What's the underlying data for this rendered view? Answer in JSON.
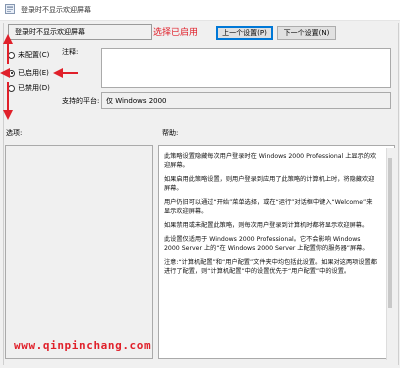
{
  "window": {
    "title": "登录时不显示欢迎屏幕"
  },
  "header": {
    "setting_name": "登录时不显示欢迎屏幕",
    "annotation": "选择已启用",
    "prev_button": "上一个设置(P)",
    "next_button": "下一个设置(N)"
  },
  "options": [
    {
      "label": "未配置(C)",
      "checked": false
    },
    {
      "label": "已启用(E)",
      "checked": true
    },
    {
      "label": "已禁用(D)",
      "checked": false
    }
  ],
  "comment": {
    "label": "注释:",
    "value": ""
  },
  "platform": {
    "label": "支持的平台:",
    "value": "仅 Windows 2000"
  },
  "sections": {
    "options_label": "选项:",
    "help_label": "帮助:"
  },
  "help": [
    "此策略设置隐藏每次用户登录时在 Windows 2000 Professional 上显示的欢迎屏幕。",
    "如果启用此策略设置，则用户登录到应用了此策略的计算机上时，将隐藏欢迎屏幕。",
    "用户仍旧可以通过“开始”菜单选择，或在“运行”对话框中键入“Welcome”来显示欢迎屏幕。",
    "如果禁用或未配置此策略，则每次用户登录到计算机时都将显示欢迎屏幕。",
    "此设置仅适用于 Windows 2000 Professional。它不会影响 Windows 2000 Server 上的“在 Windows 2000 Server 上配置你的服务器”屏幕。",
    "注意:“计算机配置”和“用户配置”文件夹中均包括此设置。如果对这两项设置都进行了配置，则“计算机配置”中的设置优先于“用户配置”中的设置。"
  ],
  "watermark": "www.qinpinchang.com",
  "colors": {
    "annotation": "#e0202a",
    "primary_border": "#0078d7"
  }
}
